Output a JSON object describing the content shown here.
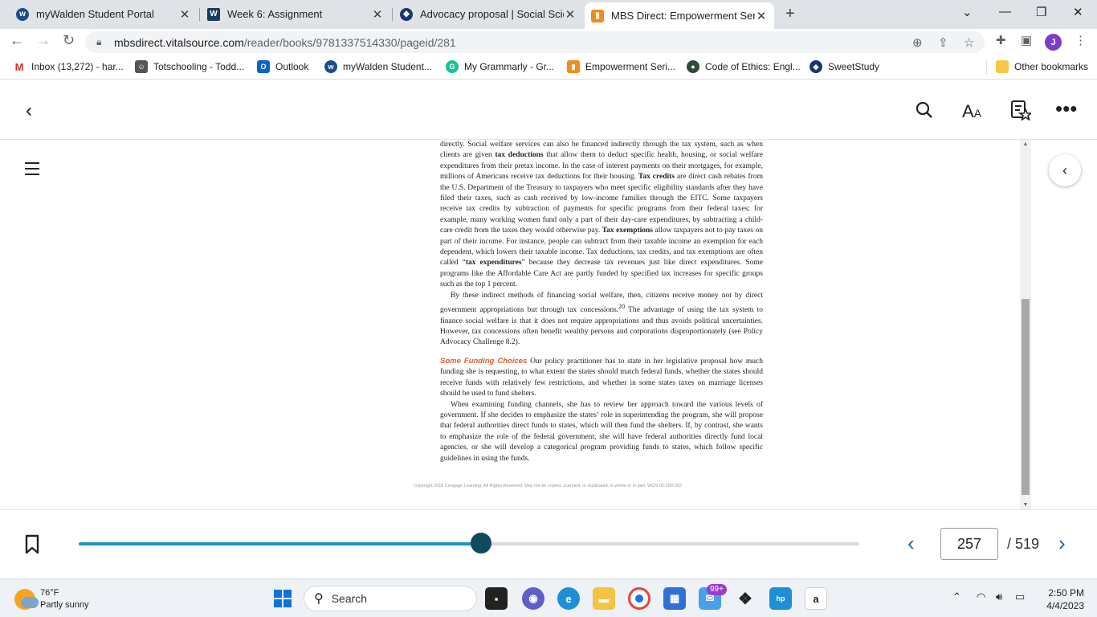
{
  "browser": {
    "tabs": [
      {
        "title": "myWalden Student Portal",
        "active": false,
        "favicon": "walden-logo-icon",
        "color": "#1e4c8a"
      },
      {
        "title": "Week 6: Assignment",
        "active": false,
        "favicon": "walden-w-icon",
        "color": "#1c3b5a"
      },
      {
        "title": "Advocacy proposal | Social Scienc",
        "active": false,
        "favicon": "sweetstudy-icon",
        "color": "#1b3570"
      },
      {
        "title": "MBS Direct: Empowerment Series",
        "active": true,
        "favicon": "mbs-bag-icon",
        "color": "#f28a1c"
      }
    ],
    "url_host": "mbsdirect.vitalsource.com",
    "url_path": "/reader/books/9781337514330/pageid/281",
    "profile_initial": "J",
    "bookmarks": [
      {
        "label": "Inbox (13,272) - har...",
        "icon": "gmail-icon",
        "color": "#d93025"
      },
      {
        "label": "Totschooling - Todd...",
        "icon": "totschooling-icon",
        "color": "#555555"
      },
      {
        "label": "Outlook",
        "icon": "outlook-icon",
        "color": "#0a64c8"
      },
      {
        "label": "myWalden Student...",
        "icon": "walden-logo-icon",
        "color": "#1e4c8a"
      },
      {
        "label": "My Grammarly - Gr...",
        "icon": "grammarly-icon",
        "color": "#15c39a"
      },
      {
        "label": "Empowerment Seri...",
        "icon": "mbs-bag-icon",
        "color": "#f28a1c"
      },
      {
        "label": "Code of Ethics: Engl...",
        "icon": "nasw-icon",
        "color": "#2f4b3a"
      },
      {
        "label": "SweetStudy",
        "icon": "sweetstudy-icon",
        "color": "#1b3570"
      }
    ],
    "other_bookmarks": "Other bookmarks"
  },
  "reader": {
    "paragraphs": [
      {
        "class": "",
        "runs": [
          {
            "t": "directly. Social welfare services can also be financed indirectly through the tax system, such as when clients are given "
          },
          {
            "t": "tax deductions",
            "b": true
          },
          {
            "t": " that allow them to deduct specific health, housing, or social welfare expenditures from their pretax income. In the case of interest payments on their mortgages, for example, millions of Americans receive tax deductions for their housing. "
          },
          {
            "t": "Tax credits",
            "b": true
          },
          {
            "t": " are direct cash rebates from the U.S. Department of the Treasury to taxpayers who meet specific eligibility standards after they have filed their taxes, such as cash received by low-income families through the EITC. Some taxpayers receive tax credits by subtraction of payments for specific programs from their federal taxes; for example, many working women fund only a part of their day-care expenditures, by subtracting a child-care credit from the taxes they would otherwise pay. "
          },
          {
            "t": "Tax exemptions",
            "b": true
          },
          {
            "t": " allow taxpayers not to pay taxes on part of their income. For instance, people can subtract from their taxable income an exemption for each dependent, which lowers their taxable income. Tax deductions, tax credits, and tax exemptions are often called “"
          },
          {
            "t": "tax expenditures",
            "b": true
          },
          {
            "t": "” because they decrease tax revenues just like direct expenditures. Some programs like the Affordable Care Act are partly funded by specified tax increases for specific groups such as the top 1 percent."
          }
        ]
      },
      {
        "class": "ind",
        "runs": [
          {
            "t": "By these indirect methods of financing social welfare, then, citizens receive money not by direct government appropriations but through tax concessions."
          },
          {
            "t": "20",
            "sup": true
          },
          {
            "t": " The advantage of using the tax system to finance social welfare is that it does not require appropriations and thus avoids political uncertainties. However, tax concessions often benefit wealthy persons and corporations disproportionately (see Policy Advocacy Challenge 8.2)."
          }
        ]
      },
      {
        "class": "gap",
        "runs": [
          {
            "t": "Some Funding Choices",
            "h": true
          },
          {
            "t": "  Our policy practitioner has to state in her legislative proposal how much funding she is requesting, to what extent the states should match federal funds, whether the states should receive funds with relatively few restrictions, and whether in some states taxes on marriage licenses should be used to fund shelters."
          }
        ]
      },
      {
        "class": "ind",
        "runs": [
          {
            "t": "When examining funding channels, she has to review her approach toward the various levels of government. If she decides to emphasize the states’ role in superintending the program, she will propose that federal authorities direct funds to states, which will then fund the shelters. If, by contrast, she wants to emphasize the role of the federal government, she will have federal authorities directly fund local agencies, or she will develop a categorical program providing funds to states, which follow specific guidelines in using the funds."
          }
        ]
      }
    ],
    "copyright": "Copyright 2018 Cengage Learning. All Rights Reserved. May not be copied, scanned, or duplicated, in whole or in part.  WCN 02-200-202",
    "current_page": "257",
    "total_pages": "/ 519",
    "progress": 0.515
  },
  "taskbar": {
    "temp": "76°F",
    "condition": "Partly sunny",
    "search_placeholder": "Search",
    "mail_badge": "99+",
    "time": "2:50 PM",
    "date": "4/4/2023"
  }
}
